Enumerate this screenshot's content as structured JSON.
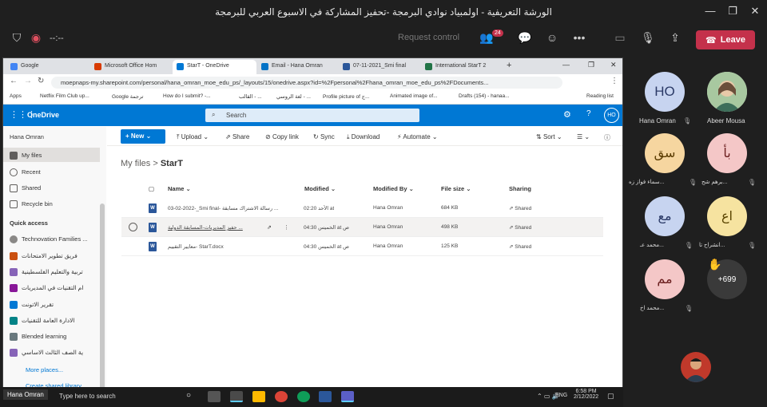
{
  "teams": {
    "title": "الورشة التعريفية - اولمبياد نوادي البرمجة -تحفيز المشاركة في الاسبوع العربي للبرمجة",
    "timer": "--:--",
    "request_control": "Request control",
    "participants_badge": "24",
    "leave_label": "Leave"
  },
  "browser": {
    "tabs": [
      "Google",
      "Microsoft Office Hom",
      "StarT - OneDrive",
      "Email - Hana Omran",
      "07-11-2021_Smi final",
      "International StarT 2"
    ],
    "url": "moepnaps-my.sharepoint.com/personal/hana_omran_moe_edu_ps/_layouts/15/onedrive.aspx?id=%2Fpersonal%2Fhana_omran_moe_edu_ps%2FDocuments...",
    "bookmarks": [
      "Apps",
      "Netflix Film Club up...",
      "Google ترجمة",
      "How do I submit? -...",
      "القالب - ...",
      "لغة الروسي - ...",
      "Profile picture of ج...",
      "Animated image of...",
      "Drafts (154) - hanaa...",
      "Reading list"
    ]
  },
  "onedrive": {
    "app_name": "OneDrive",
    "search_placeholder": "Search",
    "avatar": "HO",
    "commands": {
      "new": "New",
      "upload": "Upload",
      "share": "Share",
      "copy_link": "Copy link",
      "sync": "Sync",
      "download": "Download",
      "automate": "Automate",
      "sort": "Sort"
    },
    "sidebar": {
      "user": "Hana Omran",
      "items": [
        "My files",
        "Recent",
        "Shared",
        "Recycle bin"
      ],
      "quick_access_label": "Quick access",
      "quick_access": [
        "Technovation Families ...",
        "فريق تطوير الامتحانات",
        "تربية والتعليم الفلسطينية",
        "ام التقنيات في المديريات",
        "تقرير الاتونت",
        "الادارة العامة للتقنيات",
        "Blended learning",
        "ية الصف الثالث الاساسي"
      ],
      "more_places": "More places...",
      "create_shared": "Create shared library"
    },
    "breadcrumb": {
      "root": "My files",
      "current": "StarT"
    },
    "columns": [
      "Name",
      "Modified",
      "Modified By",
      "File size",
      "Sharing"
    ],
    "files": [
      {
        "name": "03-02-2022-_Smi final- رسالة الاشتراك مسابقة ...",
        "modified": "الأحد 02:20 at",
        "by": "Hana Omran",
        "size": "684 KB",
        "sharing": "Shared"
      },
      {
        "name": "حفيز المديريات-المسابقة الدولية ...",
        "modified": "الخميس 04:30 at ص",
        "by": "Hana Omran",
        "size": "498 KB",
        "sharing": "Shared"
      },
      {
        "name": "معايير التقييم- StarT.docx",
        "modified": "الخميس 04:30 at ص",
        "by": "Hana Omran",
        "size": "125 KB",
        "sharing": "Shared"
      }
    ]
  },
  "taskbar": {
    "search": "Type here to search",
    "presenter": "Hana Omran",
    "lang": "ENG",
    "time": "6:58 PM",
    "date": "2/12/2022"
  },
  "participants": [
    {
      "initials": "HO",
      "name": "Hana Omran",
      "color": "#c7d4f0",
      "text": "#2b3a67"
    },
    {
      "initials": "",
      "name": "Abeer Mousa",
      "color": "#d4e6d4",
      "text": "#333"
    },
    {
      "initials": "سق",
      "name": "سماء فواز زه...",
      "color": "#f6d6a0",
      "text": "#5a3b00"
    },
    {
      "initials": "بأ",
      "name": "برهم شح...",
      "color": "#f4c7c7",
      "text": "#6b1f1f"
    },
    {
      "initials": "مع",
      "name": "محمد عـ...",
      "color": "#c7d4f0",
      "text": "#2b3a67"
    },
    {
      "initials": "اع",
      "name": "انشراح تا...",
      "color": "#f6e3a0",
      "text": "#5a4400"
    },
    {
      "initials": "مم",
      "name": "محمد اخ...",
      "color": "#f4c7c7",
      "text": "#6b1f1f"
    }
  ],
  "overflow_count": "+699"
}
